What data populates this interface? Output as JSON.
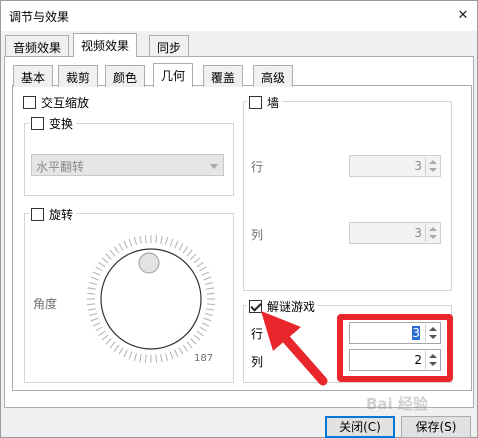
{
  "window": {
    "title": "调节与效果",
    "close_glyph": "✕"
  },
  "outer_tabs": [
    {
      "label": "音频效果",
      "active": false
    },
    {
      "label": "视频效果",
      "active": true
    },
    {
      "label": "同步",
      "active": false
    }
  ],
  "inner_tabs": [
    {
      "label": "基本",
      "active": false
    },
    {
      "label": "裁剪",
      "active": false
    },
    {
      "label": "颜色",
      "active": false
    },
    {
      "label": "几何",
      "active": true
    },
    {
      "label": "覆盖",
      "active": false
    },
    {
      "label": "高级",
      "active": false
    }
  ],
  "interactive_zoom": {
    "label": "交互缩放",
    "checked": false
  },
  "transform": {
    "label": "变换",
    "checked": false,
    "select_value": "水平翻转"
  },
  "rotate": {
    "label": "旋转",
    "checked": false,
    "angle_label": "角度",
    "angle_value": "187"
  },
  "wall": {
    "label": "墙",
    "checked": false,
    "rows_label": "行",
    "rows_value": "3",
    "cols_label": "列",
    "cols_value": "3"
  },
  "puzzle": {
    "label": "解谜游戏",
    "checked": true,
    "rows_label": "行",
    "rows_value": "3",
    "cols_label": "列",
    "cols_value": "2"
  },
  "footer": {
    "close_label": "关闭(C)",
    "save_label": "保存(S)"
  },
  "watermark": "Bai 经验",
  "colors": {
    "highlight_red": "#e8262c",
    "accent_blue": "#0078d7"
  }
}
